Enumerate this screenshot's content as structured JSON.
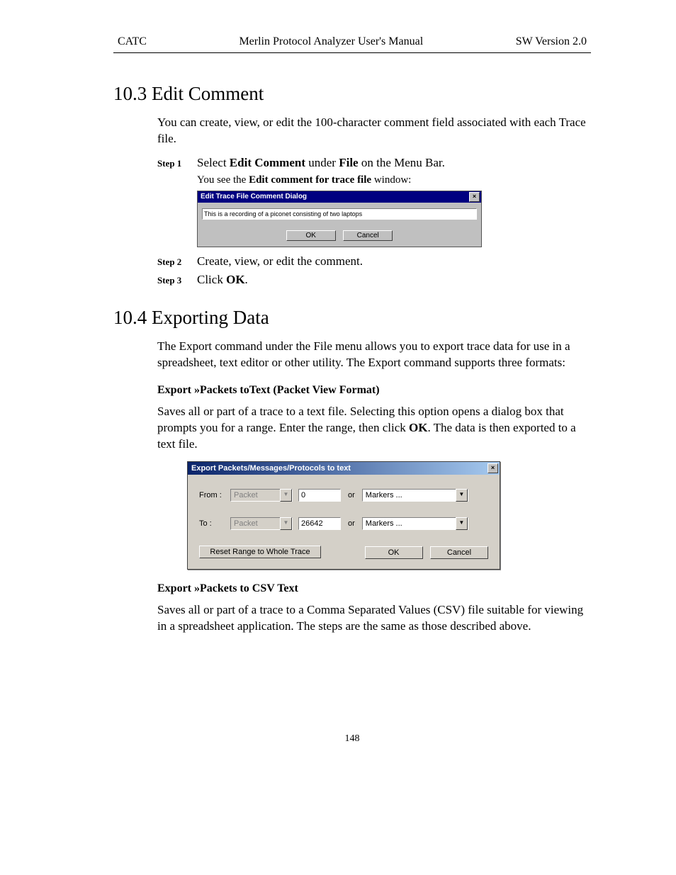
{
  "header": {
    "left": "CATC",
    "center": "Merlin Protocol Analyzer User's Manual",
    "right": "SW Version 2.0"
  },
  "sec103": {
    "heading": "10.3  Edit Comment",
    "intro": "You can create, view, or edit the 100-character comment field associated with each Trace file.",
    "step1_label": "Step 1",
    "step1_a": "Select ",
    "step1_b": "Edit Comment",
    "step1_c": " under ",
    "step1_d": "File",
    "step1_e": " on the Menu Bar.",
    "step1_sub_a": "You see the ",
    "step1_sub_b": "Edit comment for trace file",
    "step1_sub_c": " window:",
    "step2_label": "Step 2",
    "step2_text": "Create, view, or edit the comment.",
    "step3_label": "Step 3",
    "step3_a": "Click ",
    "step3_b": "OK",
    "step3_c": "."
  },
  "dlg1": {
    "title": "Edit Trace File Comment Dialog",
    "close": "×",
    "value": "This is a recording of a piconet consisting of two laptops",
    "ok": "OK",
    "cancel": "Cancel"
  },
  "sec104": {
    "heading": "10.4  Exporting Data",
    "intro": "The Export command under the File menu allows you to export trace data for use in a spreadsheet, text editor or other utility.  The Export command supports three formats:",
    "sub1": "Export »Packets toText (Packet View Format)",
    "p1_a": "Saves all or part of a trace to a text file.  Selecting this option opens a dialog box that prompts you for a range.  Enter the range, then click ",
    "p1_b": "OK",
    "p1_c": ".  The data is then exported to a text file.",
    "sub2": "Export »Packets to CSV Text",
    "p2": "Saves all or part of a trace to a Comma Separated Values (CSV) file suitable for viewing in a spreadsheet application.  The steps are the same as those described above."
  },
  "dlg2": {
    "title": "Export Packets/Messages/Protocols to text",
    "close": "×",
    "from": "From :",
    "to": "To :",
    "packet": "Packet",
    "or": "or",
    "markers": "Markers ...",
    "from_val": "0",
    "to_val": "26642",
    "reset": "Reset Range to Whole Trace",
    "ok": "OK",
    "cancel": "Cancel",
    "arrow": "▼"
  },
  "pagenum": "148"
}
